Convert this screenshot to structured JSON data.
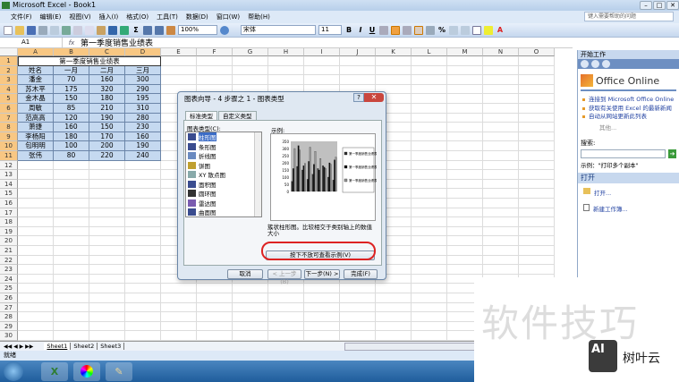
{
  "window": {
    "title": "Microsoft Excel - Book1",
    "help_placeholder": "键入需要帮助的问题",
    "controls": [
      "–",
      "□",
      "✕"
    ]
  },
  "menu": [
    "文件(F)",
    "编辑(E)",
    "视图(V)",
    "插入(I)",
    "格式(O)",
    "工具(T)",
    "数据(D)",
    "窗口(W)",
    "帮助(H)"
  ],
  "toolbar": {
    "zoom": "100%",
    "font": "宋体",
    "size": "11",
    "bold": "B",
    "italic": "I",
    "underline": "U"
  },
  "formula": {
    "namebox": "A1",
    "fx": "fx",
    "content": "第一季度销售业绩表"
  },
  "sheet": {
    "columns": [
      "A",
      "B",
      "C",
      "D",
      "E",
      "F",
      "G",
      "H",
      "I",
      "J",
      "K",
      "L",
      "M",
      "N",
      "O"
    ],
    "title": "第一季度销售业绩表",
    "headers": [
      "姓名",
      "一月",
      "二月",
      "三月"
    ],
    "rows": [
      [
        "潘金",
        "70",
        "160",
        "300"
      ],
      [
        "苏木平",
        "175",
        "320",
        "290"
      ],
      [
        "金木晶",
        "150",
        "180",
        "195"
      ],
      [
        "周敏",
        "85",
        "210",
        "310"
      ],
      [
        "范高高",
        "120",
        "190",
        "280"
      ],
      [
        "萧捷",
        "160",
        "150",
        "230"
      ],
      [
        "李杨阳",
        "180",
        "170",
        "160"
      ],
      [
        "包明明",
        "100",
        "200",
        "190"
      ],
      [
        "张伟",
        "80",
        "220",
        "240"
      ]
    ],
    "row_count": 30,
    "tabs": [
      "Sheet1",
      "Sheet2",
      "Sheet3"
    ]
  },
  "status": "就绪",
  "taskpane": {
    "title": "开始工作",
    "brand": "Office Online",
    "links": [
      "连接到 Microsoft Office Online",
      "获取有关使用 Excel 的最新新闻",
      "自动从网站更新此列表"
    ],
    "more": "其他...",
    "search_label": "搜索:",
    "example": "示例：\"打印多个副本\"",
    "open_header": "打开",
    "open_items": [
      "打开...",
      "新建工作簿..."
    ]
  },
  "dialog": {
    "title": "图表向导 - 4 步骤之 1 - 图表类型",
    "tabs": [
      "标准类型",
      "自定义类型"
    ],
    "list_label": "图表类型(C):",
    "types": [
      "柱形图",
      "条形图",
      "折线图",
      "饼图",
      "XY 散点图",
      "面积图",
      "圆环图",
      "雷达图",
      "曲面图"
    ],
    "selected_type": 0,
    "preview_label": "示例:",
    "description": "簇状柱形图。比较相交于类别轴上的数值大小",
    "preview_button": "按下不放可查看示例(V)",
    "buttons": [
      "取消",
      "< 上一步(B)",
      "下一步(N) >",
      "完成(F)"
    ],
    "preview_axis": [
      "350",
      "300",
      "250",
      "200",
      "150",
      "100",
      "50",
      "0"
    ],
    "preview_legend": [
      "第一季度销售业绩表 一月",
      "第一季度销售业绩表 二月",
      "第一季度销售业绩表 三月"
    ]
  },
  "watermark": {
    "text": "软件技巧",
    "logo": "AI",
    "brand": "树叶云"
  }
}
